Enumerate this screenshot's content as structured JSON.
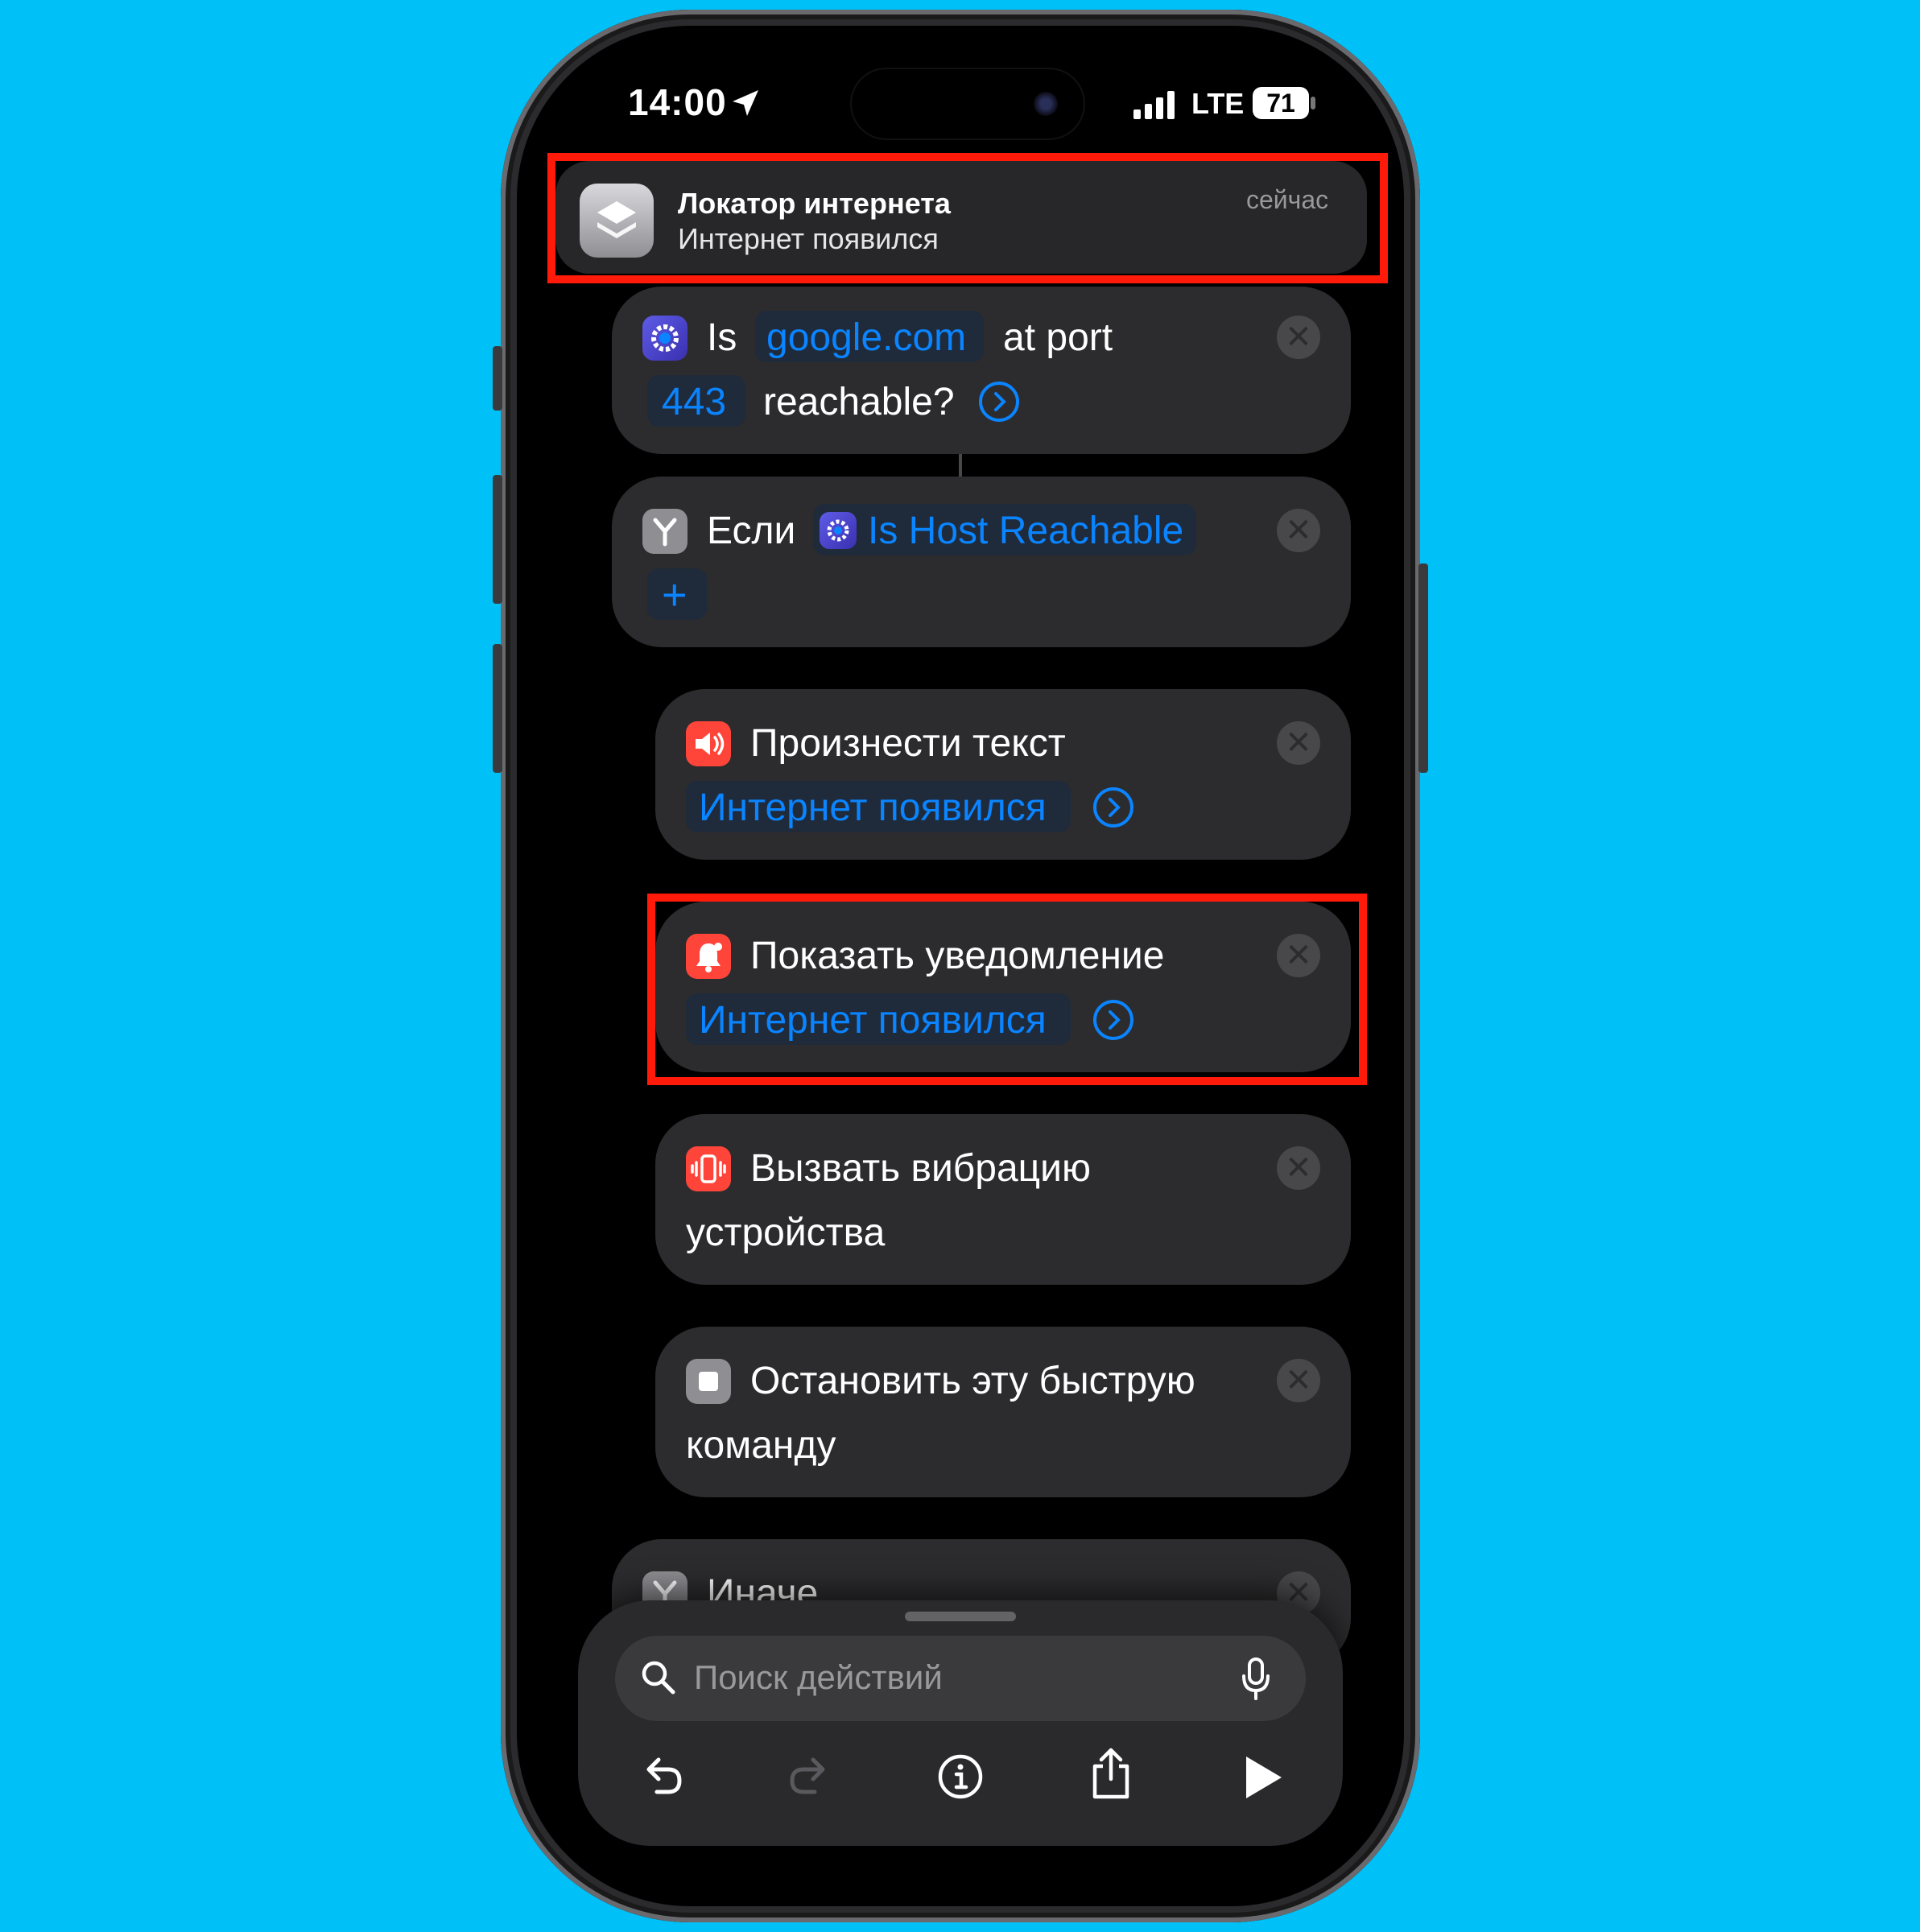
{
  "status_bar": {
    "time": "14:00",
    "network": "LTE",
    "battery": "71"
  },
  "notification": {
    "app": "Локатор интернета",
    "message": "Интернет появился",
    "time": "сейчас"
  },
  "actions": {
    "reachable": {
      "word_is": "Is",
      "host": "google.com",
      "word_port": "at port",
      "port": "443",
      "word_reachable": "reachable?"
    },
    "if_block": {
      "label": "Если",
      "variable": "Is Host Reachable",
      "add": "+"
    },
    "speak": {
      "title": "Произнести текст",
      "text": "Интернет появился"
    },
    "notify": {
      "title": "Показать уведомление",
      "text": "Интернет появился"
    },
    "vibrate": {
      "title_line1": "Вызвать вибрацию",
      "title_line2": "устройства"
    },
    "stop": {
      "title_line1": "Остановить эту быструю",
      "title_line2": "команду"
    },
    "otherwise": {
      "label": "Иначе"
    }
  },
  "search": {
    "placeholder": "Поиск действий"
  },
  "colors": {
    "background": "#00C0F8",
    "accent": "#0A84FF",
    "highlight": "#FF1A0A",
    "card": "#2C2C2E"
  }
}
